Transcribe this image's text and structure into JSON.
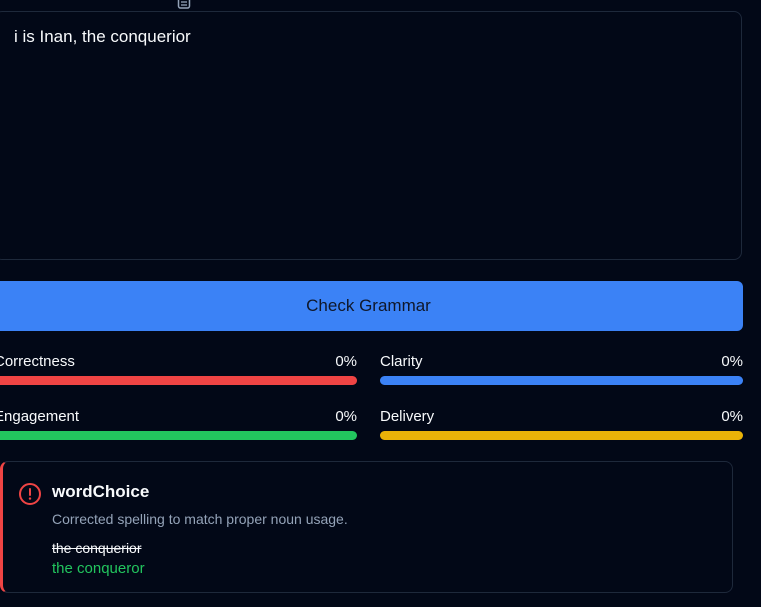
{
  "editor": {
    "text": "i is Inan, the conquerior"
  },
  "check_button": {
    "label": "Check Grammar",
    "color": "#3b82f6"
  },
  "metrics": [
    {
      "label": "Correctness",
      "value_text": "0%",
      "value": 0,
      "color": "#ef4444"
    },
    {
      "label": "Clarity",
      "value_text": "0%",
      "value": 0,
      "color": "#3b82f6"
    },
    {
      "label": "Engagement",
      "value_text": "0%",
      "value": 0,
      "color": "#22c55e"
    },
    {
      "label": "Delivery",
      "value_text": "0%",
      "value": 0,
      "color": "#eab308"
    }
  ],
  "issue": {
    "icon": "alert-circle-icon",
    "title": "wordChoice",
    "description": "Corrected spelling to match proper noun usage.",
    "original": "the conquerior",
    "suggestion": "the conqueror",
    "accent_color": "#ef4444"
  }
}
